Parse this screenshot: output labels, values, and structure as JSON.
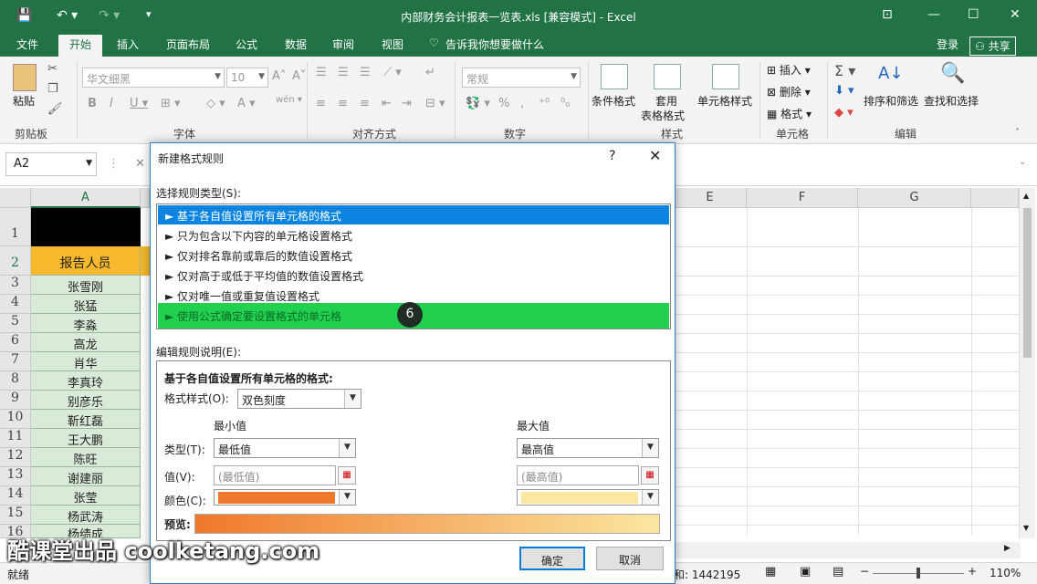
{
  "window": {
    "title": "内部财务会计报表一览表.xls  [兼容模式] - Excel",
    "qat_icons": [
      "save-icon",
      "undo-icon",
      "redo-icon",
      "customize-icon"
    ]
  },
  "tabs": [
    "文件",
    "开始",
    "插入",
    "页面布局",
    "公式",
    "数据",
    "审阅",
    "视图"
  ],
  "tell_me": "告诉我你想要做什么",
  "login": "登录",
  "share": "共享",
  "ribbon": {
    "paste": "粘贴",
    "clipboard": "剪贴板",
    "font_name": "华文细黑",
    "font_size": "10",
    "font": "字体",
    "alignment": "对齐方式",
    "number_format": "常规",
    "number": "数字",
    "cond_format": "条件格式",
    "table_format_1": "套用",
    "table_format_2": "表格格式",
    "cell_styles": "单元格样式",
    "styles": "样式",
    "insert": "插入",
    "delete": "删除",
    "format": "格式",
    "cells": "单元格",
    "sort_filter": "排序和筛选",
    "find_select": "查找和选择",
    "editing": "编辑"
  },
  "namebox": "A2",
  "columns": [
    "A",
    "E",
    "F",
    "G"
  ],
  "rows": [
    "1",
    "2",
    "3",
    "4",
    "5",
    "6",
    "7",
    "8",
    "9",
    "10",
    "11",
    "12",
    "13",
    "14",
    "15",
    "16"
  ],
  "header_cell": "报告人员",
  "names": [
    "张雪刚",
    "张猛",
    "李淼",
    "高龙",
    "肖华",
    "李真玲",
    "别彦乐",
    "靳红磊",
    "王大鹏",
    "陈旺",
    "谢建丽",
    "张莹",
    "杨武涛",
    "杨绩成"
  ],
  "status": {
    "ready": "就绪",
    "sum": "和: 1442195",
    "zoom": "110%"
  },
  "dialog": {
    "title": "新建格式规则",
    "help": "?",
    "close": "✕",
    "select_type_label": "选择规则类型(S):",
    "rules": [
      "► 基于各自值设置所有单元格的格式",
      "► 只为包含以下内容的单元格设置格式",
      "► 仅对排名靠前或靠后的数值设置格式",
      "► 仅对高于或低于平均值的数值设置格式",
      "► 仅对唯一值或重复值设置格式",
      "► 使用公式确定要设置格式的单元格"
    ],
    "badge": "6",
    "edit_desc_label": "编辑规则说明(E):",
    "desc_heading": "基于各自值设置所有单元格的格式:",
    "format_style_label": "格式样式(O):",
    "format_style": "双色刻度",
    "min_label": "最小值",
    "max_label": "最大值",
    "type_label": "类型(T):",
    "min_type": "最低值",
    "max_type": "最高值",
    "value_label": "值(V):",
    "min_value": "(最低值)",
    "max_value": "(最高值)",
    "color_label": "颜色(C):",
    "min_color": "#f0782a",
    "max_color": "#fbe7a0",
    "preview_label": "预览:",
    "ok": "确定",
    "cancel": "取消"
  },
  "watermark": "酷课堂出品 coolketang.com"
}
